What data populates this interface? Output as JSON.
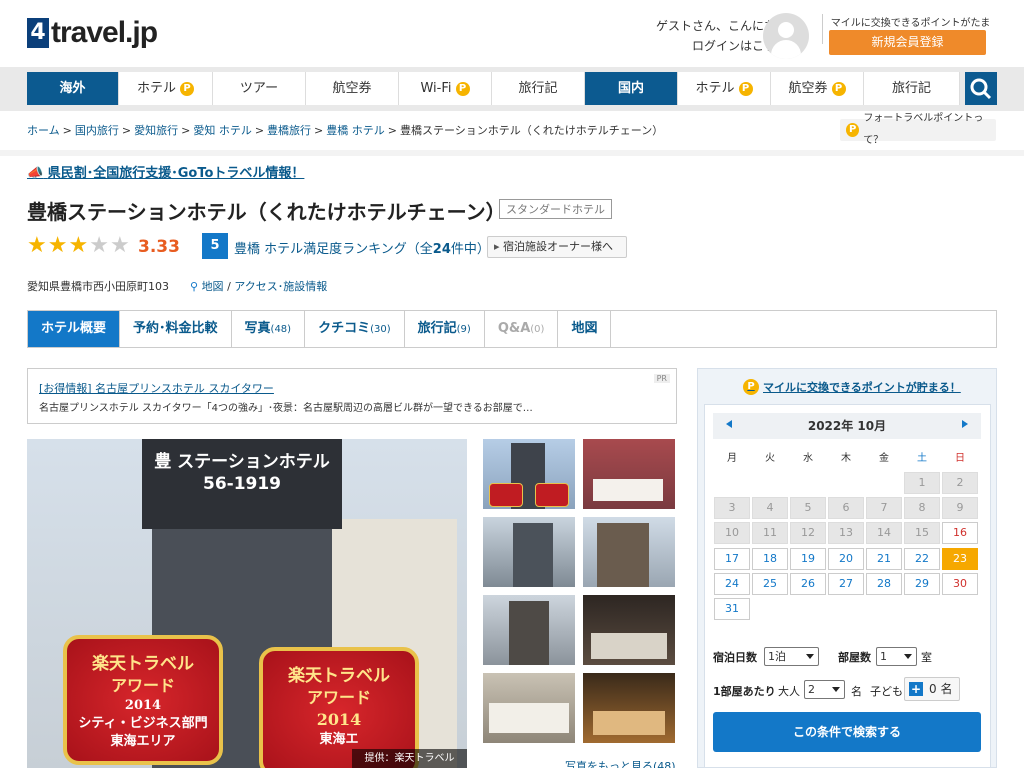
{
  "header": {
    "logo_num": "4",
    "logo_text": "travel.jp",
    "greeting": "ゲストさん、こんにちは",
    "login": "ログインはこちら",
    "mile_text": "マイルに交換できるポイントがたまる",
    "register_button": "新規会員登録"
  },
  "nav": {
    "items": [
      {
        "label": "海外",
        "dark": true,
        "point": false,
        "w": 92
      },
      {
        "label": "ホテル",
        "dark": false,
        "point": true,
        "w": 94
      },
      {
        "label": "ツアー",
        "dark": false,
        "point": false,
        "w": 93
      },
      {
        "label": "航空券",
        "dark": false,
        "point": false,
        "w": 93
      },
      {
        "label": "Wi-Fi",
        "dark": false,
        "point": true,
        "w": 93
      },
      {
        "label": "旅行記",
        "dark": false,
        "point": false,
        "w": 93
      },
      {
        "label": "国内",
        "dark": true,
        "point": false,
        "w": 93
      },
      {
        "label": "ホテル",
        "dark": false,
        "point": true,
        "w": 93
      },
      {
        "label": "航空券",
        "dark": false,
        "point": true,
        "w": 93
      },
      {
        "label": "旅行記",
        "dark": false,
        "point": false,
        "w": 96
      }
    ],
    "point_glyph": "P"
  },
  "breadcrumb": {
    "items": [
      "ホーム",
      "国内旅行",
      "愛知旅行",
      "愛知 ホテル",
      "豊橋旅行",
      "豊橋 ホテル"
    ],
    "separator": ">",
    "current": "豊橋ステーションホテル（くれたけホテルチェーン）"
  },
  "point_question": "フォートラベルポイントって？",
  "campaign": "県民割･全国旅行支援･GoToトラベル情報！",
  "hotel": {
    "name": "豊橋ステーションホテル（くれたけホテルチェーン）",
    "type": "スタンダードホテル",
    "rating": 3.33,
    "rating_text": "3.33",
    "rank": "5",
    "rank_area": "豊橋",
    "rank_label": "ホテル満足度ランキング（全",
    "rank_total": "24",
    "rank_suffix": "件中）",
    "owner_button": "宿泊施設オーナー様へ",
    "address": "愛知県豊橋市西小田原町103",
    "map_link": "地図",
    "slash": "/",
    "access_link": "アクセス･施設情報"
  },
  "tabs": [
    {
      "label": "ホテル概要",
      "count": "",
      "state": "act"
    },
    {
      "label": "予約･料金比較",
      "count": "",
      "state": ""
    },
    {
      "label": "写真",
      "count": "(48)",
      "state": ""
    },
    {
      "label": "クチコミ",
      "count": "(30)",
      "state": ""
    },
    {
      "label": "旅行記",
      "count": "(9)",
      "state": ""
    },
    {
      "label": "Q&A",
      "count": "(0)",
      "state": "dis"
    },
    {
      "label": "地図",
      "count": "",
      "state": ""
    }
  ],
  "pr": {
    "title": "[お得情報] 名古屋プリンスホテル スカイタワー",
    "desc": "名古屋プリンスホテル スカイタワー「4つの強み」･夜景：名古屋駅周辺の高層ビル群が一望できるお部屋で…",
    "tag": "PR"
  },
  "photo": {
    "sign_line1": "豊 ステーションホテル",
    "sign_line2": "56-1919",
    "award_left": {
      "l1": "楽天トラベル",
      "l2": "アワード",
      "l3": "2014",
      "l4": "シティ・ビジネス部門",
      "l5": "東海エリア"
    },
    "award_right": {
      "l1": "楽天トラベル",
      "l2": "アワード",
      "l3": "2014",
      "l4": "東海エ"
    },
    "credit": "提供：楽天トラベル",
    "more": "写真をもっと見る(48)"
  },
  "sidebar": {
    "mile_link": "マイルに交換できるポイントが貯まる！",
    "calendar": {
      "month": "2022年 10月",
      "weekdays": [
        "月",
        "火",
        "水",
        "木",
        "金",
        "土",
        "日"
      ],
      "days": [
        {
          "d": "1",
          "c": 5,
          "r": 0,
          "past": true
        },
        {
          "d": "2",
          "c": 6,
          "r": 0,
          "past": true
        },
        {
          "d": "3",
          "c": 0,
          "r": 1,
          "past": true
        },
        {
          "d": "4",
          "c": 1,
          "r": 1,
          "past": true
        },
        {
          "d": "5",
          "c": 2,
          "r": 1,
          "past": true
        },
        {
          "d": "6",
          "c": 3,
          "r": 1,
          "past": true
        },
        {
          "d": "7",
          "c": 4,
          "r": 1,
          "past": true
        },
        {
          "d": "8",
          "c": 5,
          "r": 1,
          "past": true
        },
        {
          "d": "9",
          "c": 6,
          "r": 1,
          "past": true
        },
        {
          "d": "10",
          "c": 0,
          "r": 2,
          "past": true
        },
        {
          "d": "11",
          "c": 1,
          "r": 2,
          "past": true
        },
        {
          "d": "12",
          "c": 2,
          "r": 2,
          "past": true
        },
        {
          "d": "13",
          "c": 3,
          "r": 2,
          "past": true
        },
        {
          "d": "14",
          "c": 4,
          "r": 2,
          "past": true
        },
        {
          "d": "15",
          "c": 5,
          "r": 2,
          "past": true
        },
        {
          "d": "16",
          "c": 6,
          "r": 2,
          "past": false
        },
        {
          "d": "17",
          "c": 0,
          "r": 3,
          "past": false
        },
        {
          "d": "18",
          "c": 1,
          "r": 3,
          "past": false
        },
        {
          "d": "19",
          "c": 2,
          "r": 3,
          "past": false
        },
        {
          "d": "20",
          "c": 3,
          "r": 3,
          "past": false
        },
        {
          "d": "21",
          "c": 4,
          "r": 3,
          "past": false
        },
        {
          "d": "22",
          "c": 5,
          "r": 3,
          "past": false
        },
        {
          "d": "23",
          "c": 6,
          "r": 3,
          "past": false,
          "today": true
        },
        {
          "d": "24",
          "c": 0,
          "r": 4,
          "past": false
        },
        {
          "d": "25",
          "c": 1,
          "r": 4,
          "past": false
        },
        {
          "d": "26",
          "c": 2,
          "r": 4,
          "past": false
        },
        {
          "d": "27",
          "c": 3,
          "r": 4,
          "past": false
        },
        {
          "d": "28",
          "c": 4,
          "r": 4,
          "past": false
        },
        {
          "d": "29",
          "c": 5,
          "r": 4,
          "past": false
        },
        {
          "d": "30",
          "c": 6,
          "r": 4,
          "past": false
        },
        {
          "d": "31",
          "c": 0,
          "r": 5,
          "past": false
        }
      ]
    },
    "nights_label": "宿泊日数",
    "nights_value": "1泊",
    "rooms_label": "部屋数",
    "rooms_value": "1",
    "rooms_unit": "室",
    "per_room_label": "1部屋あたり",
    "adults_label": "大人",
    "adults_value": "2",
    "adults_unit": "名",
    "children_label": "子ども",
    "children_value": "0 名",
    "search_button": "この条件で検索する"
  },
  "colors": {
    "brand_blue": "#0c5a90",
    "accent_orange": "#ef8a2a",
    "star": "#f6b400",
    "today": "#f6a800"
  }
}
